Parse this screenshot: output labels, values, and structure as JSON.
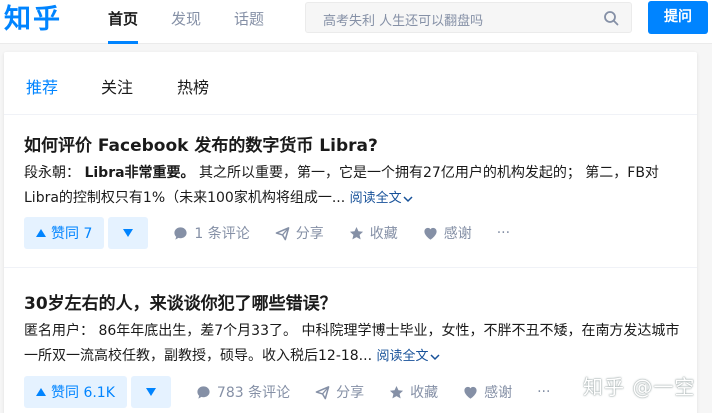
{
  "header": {
    "logo": "知乎",
    "nav": [
      {
        "label": "首页",
        "active": true
      },
      {
        "label": "发现",
        "active": false
      },
      {
        "label": "话题",
        "active": false
      }
    ],
    "search_placeholder": "高考失利 人生还可以翻盘吗",
    "ask_label": "提问"
  },
  "tabs": [
    {
      "label": "推荐",
      "active": true
    },
    {
      "label": "关注",
      "active": false
    },
    {
      "label": "热榜",
      "active": false
    }
  ],
  "feed": [
    {
      "title": "如何评价 Facebook 发布的数字货币 Libra?",
      "author": "段永朝：",
      "bold_text": "Libra非常重要。",
      "excerpt": "其之所以重要，第一，它是一个拥有27亿用户的机构发起的； 第二，FB对Libra的控制权只有1%（未来100家机构将组成一...",
      "read_more": "阅读全文",
      "vote_label": "▲ 赞同 7",
      "vote_count_label": "赞同 7",
      "comment_label": "1 条评论",
      "share_label": "分享",
      "collect_label": "收藏",
      "thanks_label": "感谢",
      "more_label": "···"
    },
    {
      "title": "30岁左右的人，来谈谈你犯了哪些错误？",
      "author": "匿名用户：",
      "excerpt": "86年年底出生，差7个月33了。 中科院理学博士毕业，女性，不胖不丑不矮，在南方发达城市一所双一流高校任教，副教授，硕导。收入税后12-18...",
      "read_more": "阅读全文",
      "vote_count_label": "赞同 6.1K",
      "comment_label": "783 条评论",
      "share_label": "分享",
      "collect_label": "收藏",
      "thanks_label": "感谢",
      "more_label": "···"
    }
  ],
  "watermark": "知乎 @一空",
  "colors": {
    "brand": "#0084ff",
    "vote_bg": "#e5f2ff",
    "muted": "#8590a6",
    "link": "#175199"
  }
}
